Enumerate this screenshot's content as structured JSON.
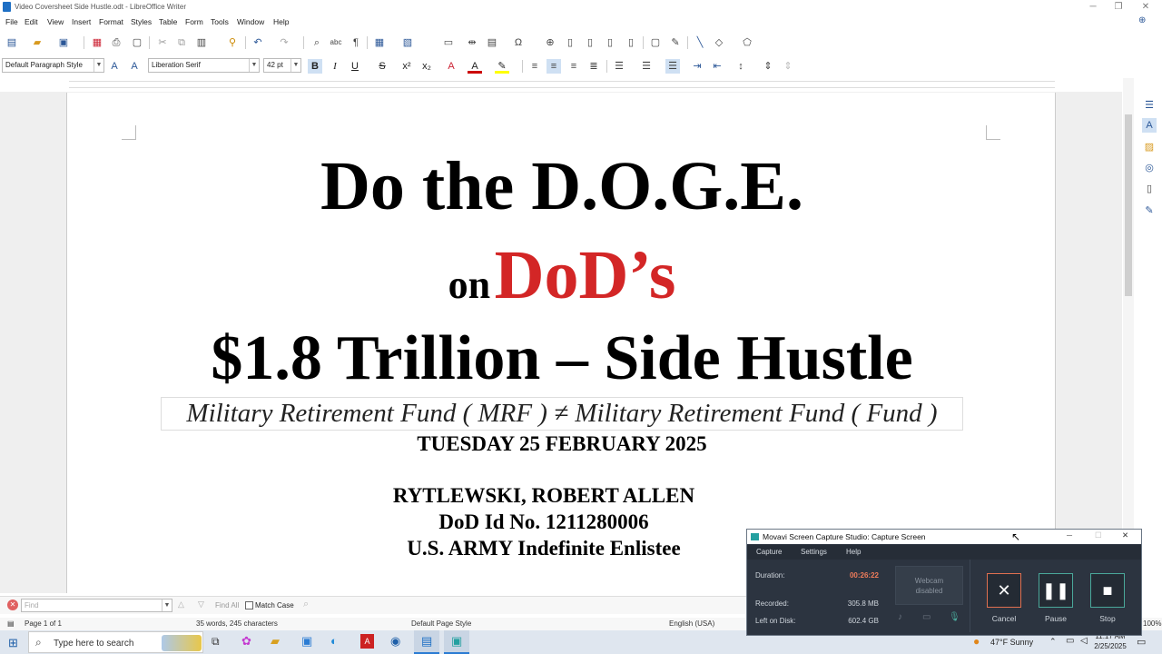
{
  "window": {
    "title": "Video Coversheet  Side Hustle.odt - LibreOffice Writer"
  },
  "menu": [
    "File",
    "Edit",
    "View",
    "Insert",
    "Format",
    "Styles",
    "Table",
    "Form",
    "Tools",
    "Window",
    "Help"
  ],
  "formatting": {
    "paragraph_style": "Default Paragraph Style",
    "font_name": "Liberation Serif",
    "font_size": "42 pt"
  },
  "document": {
    "line1": "Do the D.O.G.E.",
    "line2_prefix": "on",
    "line2_highlight": "DoD’s",
    "line3": "$1.8 Trillion – Side Hustle",
    "formula": "Military Retirement Fund ( MRF ) ≠ Military Retirement Fund ( Fund )",
    "date": "TUESDAY 25 FEBRUARY 2025",
    "name": "RYTLEWSKI, ROBERT ALLEN",
    "dod_id": "DoD Id No. 1211280006",
    "service": "U.S. ARMY Indefinite Enlistee",
    "highlight_color": "#d32626"
  },
  "findbar": {
    "placeholder": "Find",
    "find_all": "Find All",
    "match_case": "Match Case"
  },
  "status": {
    "page": "Page 1 of 1",
    "words": "35 words, 245 characters",
    "page_style": "Default Page Style",
    "language": "English (USA)",
    "zoom": "100%"
  },
  "taskbar": {
    "search_placeholder": "Type here to search",
    "weather": "47°F  Sunny",
    "time": "11:17 AM",
    "date": "2/25/2025"
  },
  "movavi": {
    "title": "Movavi Screen Capture Studio: Capture Screen",
    "menu": [
      "Capture",
      "Settings",
      "Help"
    ],
    "duration_label": "Duration:",
    "duration": "00:26:22",
    "recorded_label": "Recorded:",
    "recorded": "305.8 MB",
    "disk_label": "Left on Disk:",
    "disk": "602.4 GB",
    "webcam": "Webcam disabled",
    "cancel": "Cancel",
    "pause": "Pause",
    "stop": "Stop",
    "accent": "#4aa89a",
    "duration_color": "#f07c5a"
  }
}
